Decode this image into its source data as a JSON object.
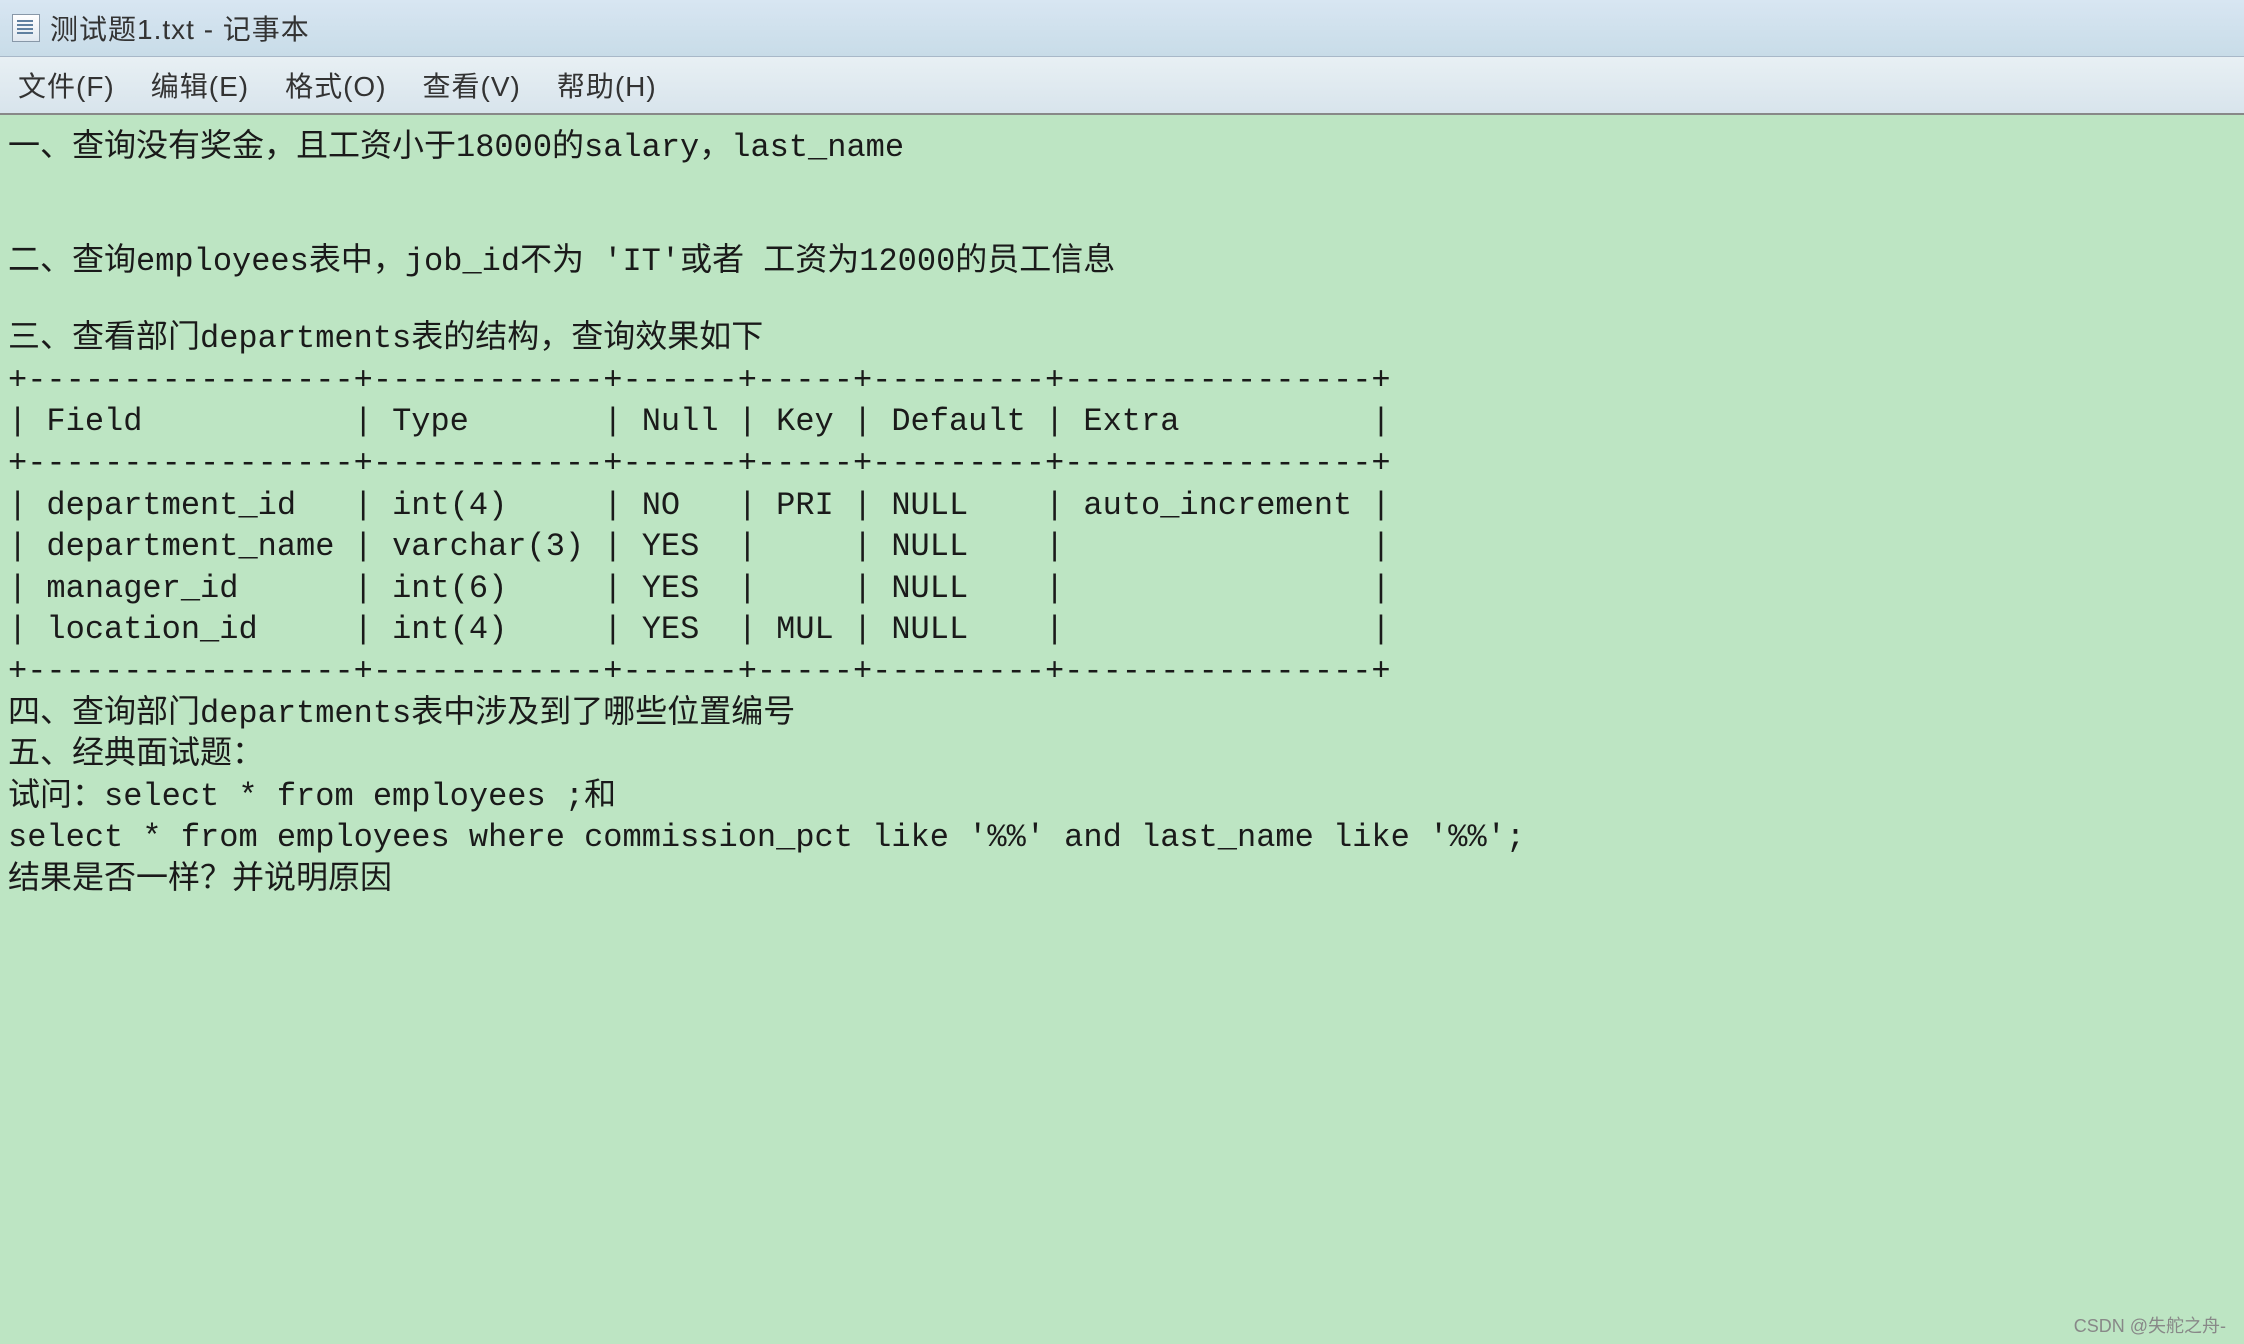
{
  "title": "测试题1.txt - 记事本",
  "menu": {
    "file": "文件(F)",
    "edit": "编辑(E)",
    "format": "格式(O)",
    "view": "查看(V)",
    "help": "帮助(H)"
  },
  "content": {
    "line1": "一、查询没有奖金，且工资小于18000的salary，last_name",
    "line2": "",
    "line3": "",
    "line4": "二、查询employees表中，job_id不为 'IT'或者 工资为12000的员工信息",
    "line5": "",
    "line6": "三、查看部门departments表的结构，查询效果如下",
    "table_sep": "+-----------------+------------+------+-----+---------+----------------+",
    "table_head": "| Field           | Type       | Null | Key | Default | Extra          |",
    "table_sep2": "+-----------------+------------+------+-----+---------+----------------+",
    "table_r1": "| department_id   | int(4)     | NO   | PRI | NULL    | auto_increment |",
    "table_r2": "| department_name | varchar(3) | YES  |     | NULL    |                |",
    "table_r3": "| manager_id      | int(6)     | YES  |     | NULL    |                |",
    "table_r4": "| location_id     | int(4)     | YES  | MUL | NULL    |                |",
    "table_sep3": "+-----------------+------------+------+-----+---------+----------------+",
    "line7": "四、查询部门departments表中涉及到了哪些位置编号",
    "line8": "五、经典面试题：",
    "line9": "试问：select * from employees ;和",
    "line10": "select * from employees where commission_pct like '%%' and last_name like '%%';",
    "line11": "结果是否一样？并说明原因"
  },
  "watermark": "CSDN @失舵之舟-"
}
